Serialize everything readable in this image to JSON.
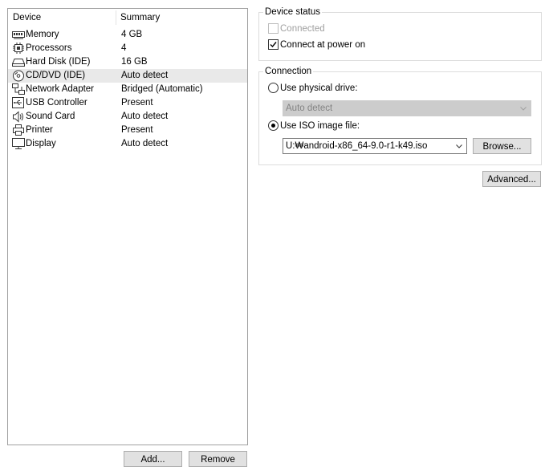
{
  "device_list": {
    "columns": {
      "device": "Device",
      "summary": "Summary"
    },
    "rows": [
      {
        "device": "Memory",
        "summary": "4 GB",
        "icon": "memory-icon"
      },
      {
        "device": "Processors",
        "summary": "4",
        "icon": "processor-icon"
      },
      {
        "device": "Hard Disk (IDE)",
        "summary": "16 GB",
        "icon": "hard-disk-icon"
      },
      {
        "device": "CD/DVD (IDE)",
        "summary": "Auto detect",
        "icon": "cd-dvd-icon",
        "selected": true
      },
      {
        "device": "Network Adapter",
        "summary": "Bridged (Automatic)",
        "icon": "network-adapter-icon"
      },
      {
        "device": "USB Controller",
        "summary": "Present",
        "icon": "usb-icon"
      },
      {
        "device": "Sound Card",
        "summary": "Auto detect",
        "icon": "sound-card-icon"
      },
      {
        "device": "Printer",
        "summary": "Present",
        "icon": "printer-icon"
      },
      {
        "device": "Display",
        "summary": "Auto detect",
        "icon": "display-icon"
      }
    ]
  },
  "buttons": {
    "add": "Add...",
    "remove": "Remove",
    "browse": "Browse...",
    "advanced": "Advanced..."
  },
  "device_status": {
    "title": "Device status",
    "connected": {
      "label": "Connected",
      "checked": false,
      "enabled": false
    },
    "connect_at_power_on": {
      "label": "Connect at power on",
      "checked": true
    }
  },
  "connection": {
    "title": "Connection",
    "physical_drive": {
      "label": "Use physical drive:",
      "selected": false,
      "value": "Auto detect"
    },
    "iso_image": {
      "label": "Use ISO image file:",
      "selected": true,
      "value": "U:₩android-x86_64-9.0-r1-k49.iso"
    }
  }
}
